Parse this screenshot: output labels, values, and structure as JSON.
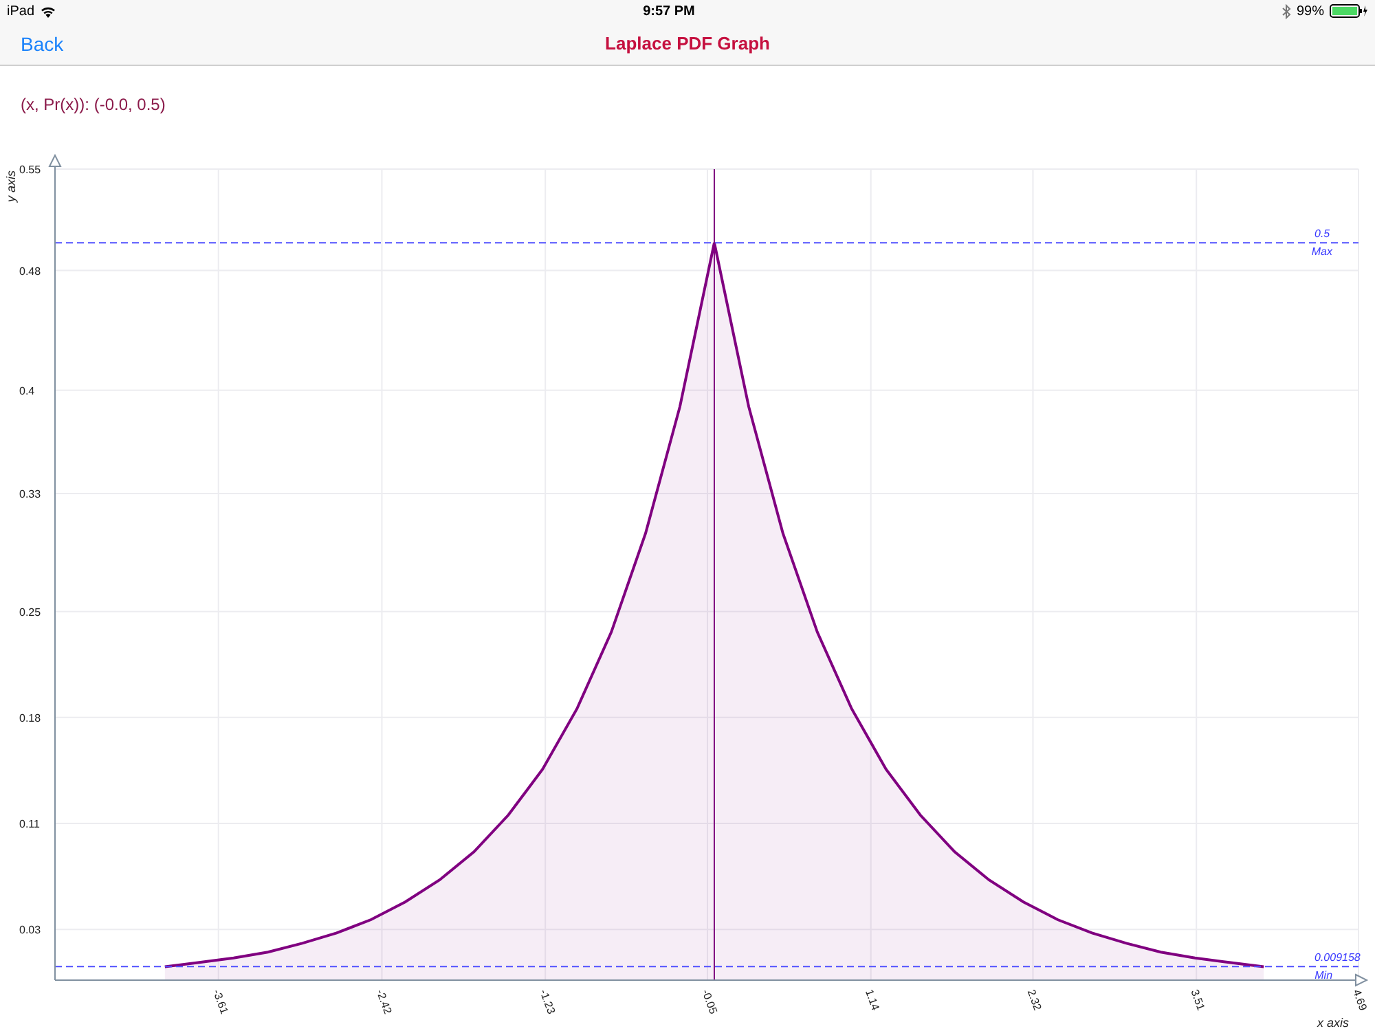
{
  "status_bar": {
    "device": "iPad",
    "time": "9:57 PM",
    "battery": "99%"
  },
  "nav_bar": {
    "back": "Back",
    "title": "Laplace PDF Graph"
  },
  "readout": "(x, Pr(x)): (-0.0, 0.5)",
  "chart": {
    "chart_data": {
      "type": "area",
      "xlabel": "x axis",
      "ylabel": "y axis",
      "x": [
        -4,
        -3.75,
        -3.5,
        -3.25,
        -3,
        -2.75,
        -2.5,
        -2.25,
        -2,
        -1.75,
        -1.5,
        -1.25,
        -1,
        -0.75,
        -0.5,
        -0.25,
        0,
        0.25,
        0.5,
        0.75,
        1,
        1.25,
        1.5,
        1.75,
        2,
        2.25,
        2.5,
        2.75,
        3,
        3.25,
        3.5,
        3.75,
        4
      ],
      "grid": true,
      "series": [
        {
          "color": "#800080",
          "values": [
            0.009,
            0.012,
            0.015,
            0.019,
            0.025,
            0.032,
            0.041,
            0.053,
            0.068,
            0.087,
            0.112,
            0.143,
            0.184,
            0.236,
            0.303,
            0.389,
            0.5,
            0.389,
            0.303,
            0.236,
            0.184,
            0.143,
            0.112,
            0.087,
            0.068,
            0.053,
            0.041,
            0.032,
            0.025,
            0.019,
            0.015,
            0.012,
            0.009
          ]
        }
      ],
      "xlim": [
        -4.8,
        4.69
      ],
      "ylim": [
        0,
        0.55
      ],
      "xticks": [
        {
          "value": -3.61,
          "label": "-3.61"
        },
        {
          "value": -2.42,
          "label": "-2.42"
        },
        {
          "value": -1.23,
          "label": "-1.23"
        },
        {
          "value": -0.05,
          "label": "-0.05"
        },
        {
          "value": 1.14,
          "label": "1.14"
        },
        {
          "value": 2.32,
          "label": "2.32"
        },
        {
          "value": 3.51,
          "label": "3.51"
        },
        {
          "value": 4.69,
          "label": "4.69"
        }
      ],
      "yticks": [
        {
          "value": 0.034375,
          "label": "0.03"
        },
        {
          "value": 0.10625,
          "label": "0.11"
        },
        {
          "value": 0.178125,
          "label": "0.18"
        },
        {
          "value": 0.25,
          "label": "0.25"
        },
        {
          "value": 0.33,
          "label": "0.33"
        },
        {
          "value": 0.4,
          "label": "0.4"
        },
        {
          "value": 0.48125,
          "label": "0.48"
        },
        {
          "value": 0.55,
          "label": "0.55"
        }
      ],
      "ref_lines": [
        {
          "axis": "y",
          "value": 0.5,
          "label": "0.5"
        },
        {
          "axis": "y",
          "value": 0.009158,
          "label": "0.009158"
        },
        {
          "axis": "x",
          "value": 0
        }
      ],
      "annotations": [
        {
          "text": "Max",
          "x": 4.5,
          "y": 0.5
        },
        {
          "text": "Min",
          "x": 4.5,
          "y": 0.009158
        }
      ]
    }
  }
}
